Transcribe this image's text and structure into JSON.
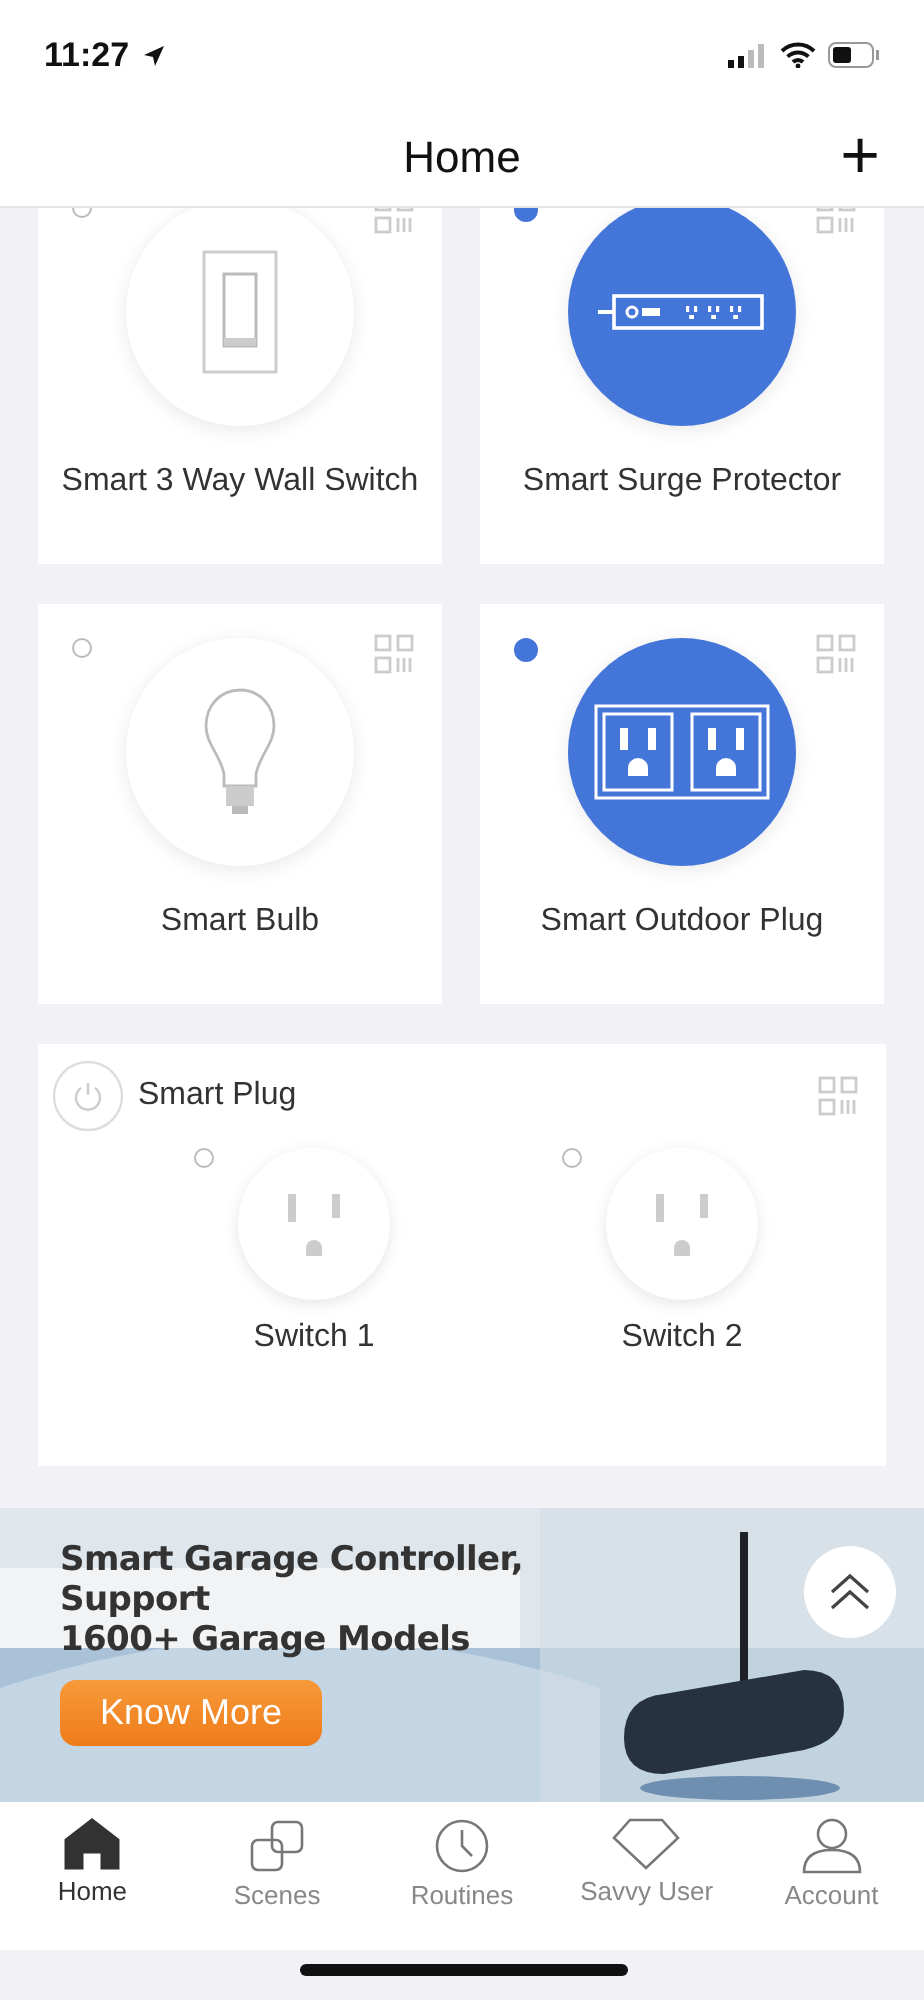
{
  "status_bar": {
    "time": "11:27"
  },
  "header": {
    "title": "Home",
    "add_button": "+"
  },
  "devices": [
    {
      "name": "Smart 3 Way Wall Switch",
      "kind": "wall-switch",
      "on": false
    },
    {
      "name": "Smart Surge Protector",
      "kind": "surge-protector",
      "on": true
    },
    {
      "name": "Smart Bulb",
      "kind": "bulb",
      "on": false
    },
    {
      "name": "Smart Outdoor Plug",
      "kind": "outdoor-plug",
      "on": true
    }
  ],
  "multi_plug": {
    "name": "Smart Plug",
    "switches": [
      {
        "name": "Switch 1",
        "on": false
      },
      {
        "name": "Switch 2",
        "on": false
      }
    ]
  },
  "banner": {
    "headline": [
      "Smart Garage Controller,",
      "Support",
      "1600+ Garage Models"
    ],
    "button": "Know More"
  },
  "tabs": [
    {
      "label": "Home",
      "kind": "home",
      "selected": true
    },
    {
      "label": "Scenes",
      "kind": "scenes",
      "selected": false
    },
    {
      "label": "Routines",
      "kind": "routines",
      "selected": false
    },
    {
      "label": "Savvy User",
      "kind": "savvy",
      "selected": false
    },
    {
      "label": "Account",
      "kind": "account",
      "selected": false
    }
  ]
}
